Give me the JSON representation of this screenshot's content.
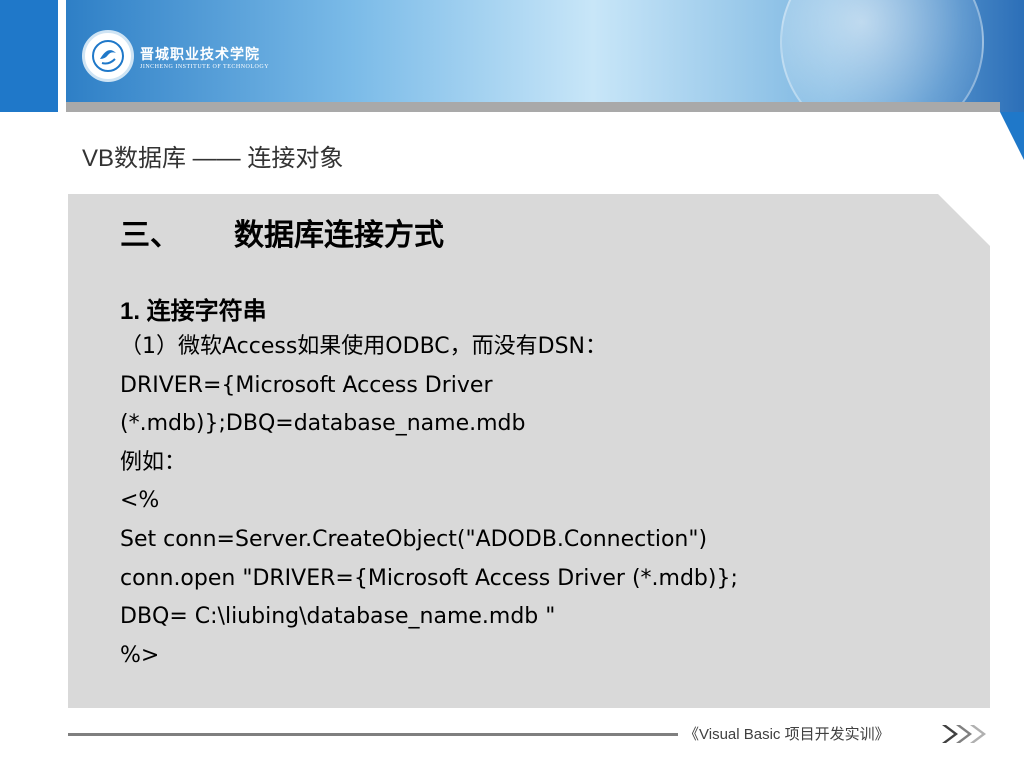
{
  "header": {
    "school_name": "晋城职业技术学院",
    "school_name_en": "JINCHENG INSTITUTE OF TECHNOLOGY"
  },
  "slide": {
    "title": "VB数据库 —— 连接对象",
    "section_number": "三、",
    "section_title": "数据库连接方式",
    "subsection": "1.  连接字符串",
    "lines": [
      "（1）微软Access如果使用ODBC，而没有DSN：",
      "DRIVER={Microsoft Access Driver",
      "(*.mdb)};DBQ=database_name.mdb",
      "例如：",
      "<%",
      "Set conn=Server.CreateObject(\"ADODB.Connection\")",
      "conn.open \"DRIVER={Microsoft Access Driver (*.mdb)};",
      "DBQ= C:\\liubing\\database_name.mdb \"",
      "%>"
    ]
  },
  "footer": {
    "course": "《Visual Basic  项目开发实训》",
    "arrows_icon": "triple-chevron-right-icon"
  },
  "colors": {
    "banner_blue": "#1f78c9",
    "content_background": "#d9d9d9",
    "footer_line": "#7f7f7f"
  }
}
